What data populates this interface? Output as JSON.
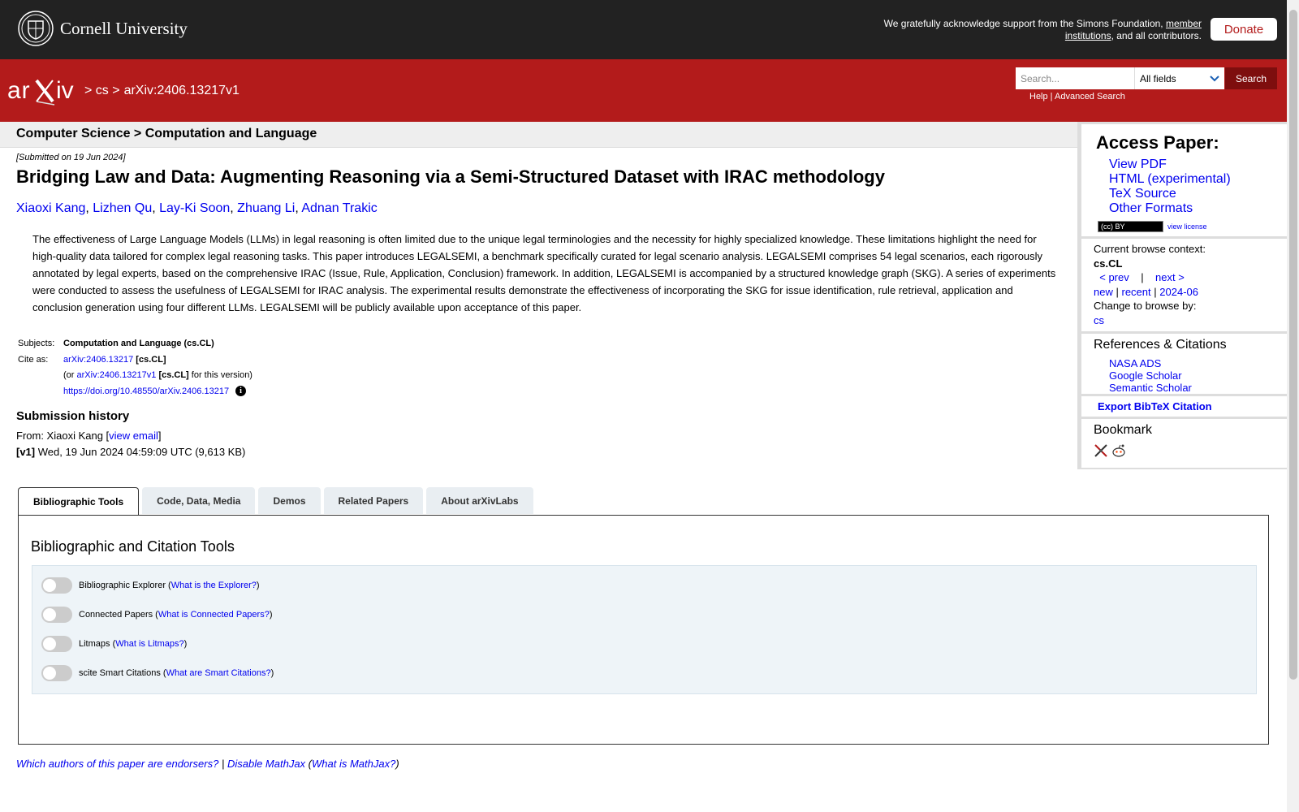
{
  "header": {
    "institution": "Cornell University",
    "support_text": "We gratefully acknowledge support from the Simons Foundation,",
    "support_link": "member institutions",
    "support_suffix": ", and all contributors.",
    "donate": "Donate"
  },
  "nav": {
    "crumb_cs": "> cs >",
    "crumb_id": "arXiv:2406.13217v1",
    "search_placeholder": "Search...",
    "field_select": "All fields",
    "search_button": "Search",
    "help": "Help",
    "sep": " | ",
    "advanced": "Advanced Search"
  },
  "paper": {
    "subject_header": "Computer Science > Computation and Language",
    "submitted": "[Submitted on 19 Jun 2024]",
    "title": "Bridging Law and Data: Augmenting Reasoning via a Semi-Structured Dataset with IRAC methodology",
    "authors": [
      "Xiaoxi Kang",
      "Lizhen Qu",
      "Lay-Ki Soon",
      "Zhuang Li",
      "Adnan Trakic"
    ],
    "abstract": "The effectiveness of Large Language Models (LLMs) in legal reasoning is often limited due to the unique legal terminologies and the necessity for highly specialized knowledge. These limitations highlight the need for high-quality data tailored for complex legal reasoning tasks. This paper introduces LEGALSEMI, a benchmark specifically curated for legal scenario analysis. LEGALSEMI comprises 54 legal scenarios, each rigorously annotated by legal experts, based on the comprehensive IRAC (Issue, Rule, Application, Conclusion) framework. In addition, LEGALSEMI is accompanied by a structured knowledge graph (SKG). A series of experiments were conducted to assess the usefulness of LEGALSEMI for IRAC analysis. The experimental results demonstrate the effectiveness of incorporating the SKG for issue identification, rule retrieval, application and conclusion generation using four different LLMs. LEGALSEMI will be publicly available upon acceptance of this paper.",
    "subjects_label": "Subjects:",
    "subjects_value": "Computation and Language (cs.CL)",
    "cite_label": "Cite as:",
    "cite_id": "arXiv:2406.13217",
    "cite_cat": "[cs.CL]",
    "or_prefix": "(or",
    "or_id": "arXiv:2406.13217v1",
    "or_cat": "[cs.CL]",
    "or_suffix": "for this version)",
    "doi": "https://doi.org/10.48550/arXiv.2406.13217",
    "history_title": "Submission history",
    "from_prefix": "From: Xiaoxi Kang [",
    "from_link": "view email",
    "from_suffix": "]",
    "v1_label": "[v1]",
    "v1_text": "Wed, 19 Jun 2024 04:59:09 UTC (9,613 KB)"
  },
  "sidebar": {
    "access_title": "Access Paper:",
    "formats": [
      "View PDF",
      "HTML (experimental)",
      "TeX Source",
      "Other Formats"
    ],
    "license_badge": "(cc) BY",
    "view_license": "view license",
    "browse_context": "Current browse context:",
    "context": "cs.CL",
    "prev": "< prev",
    "pipe": "|",
    "next": "next >",
    "new": "new",
    "recent": "recent",
    "month": "2024-06",
    "change_browse": "Change to browse by:",
    "cs": "cs",
    "refs_title": "References & Citations",
    "refs": [
      "NASA ADS",
      "Google Scholar",
      "Semantic Scholar"
    ],
    "export": "Export BibTeX Citation",
    "bookmark": "Bookmark"
  },
  "tabs": [
    "Bibliographic Tools",
    "Code, Data, Media",
    "Demos",
    "Related Papers",
    "About arXivLabs"
  ],
  "tools": {
    "title": "Bibliographic and Citation Tools",
    "items": [
      {
        "label": "Bibliographic Explorer",
        "help": "What is the Explorer?"
      },
      {
        "label": "Connected Papers",
        "help": "What is Connected Papers?"
      },
      {
        "label": "Litmaps",
        "help": "What is Litmaps?"
      },
      {
        "label": "scite Smart Citations",
        "help": "What are Smart Citations?"
      }
    ]
  },
  "footer": {
    "endorsers": "Which authors of this paper are endorsers?",
    "sep": "|",
    "disable_mathjax": "Disable MathJax",
    "what_mathjax": "What is MathJax?"
  }
}
